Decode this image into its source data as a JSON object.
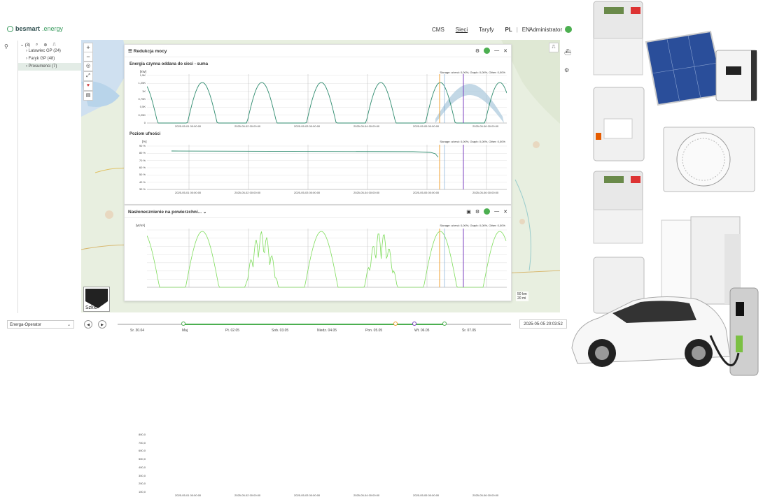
{
  "header": {
    "logo_brand": "besmart",
    "logo_suffix": ".energy",
    "nav": [
      "CMS",
      "Sieci",
      "Taryfy"
    ],
    "nav_active": "Sieci",
    "lang_pl": "PL",
    "lang_sep": "|",
    "lang_en": "EN",
    "user": "Administrator"
  },
  "tree": {
    "root": "(3)",
    "items": [
      {
        "label": "Latawiec GP (24)",
        "selected": false
      },
      {
        "label": "Faryk GP (48)",
        "selected": false
      },
      {
        "label": "Prosumenci (7)",
        "selected": true
      }
    ]
  },
  "panel1": {
    "title": "Redukcja mocy",
    "chart1": {
      "title": "Energia czynna oddana do sieci - suma",
      "unit": "[kW]",
      "stat": "Storage: at end: 0,00%, Graph: 0,00%, Other: 0,00%",
      "yticks": [
        "1,5K",
        "1,25K",
        "1K",
        "0,75K",
        "0,5K",
        "0,25K",
        "0"
      ],
      "xticks": [
        "2025-05-01 00:00:00",
        "2025-05-02 00:00:00",
        "2025-05-03 00:00:00",
        "2025-05-04 00:00:00",
        "2025-05-05 00:00:00",
        "2025-05-06 00:00:00"
      ]
    },
    "chart2": {
      "title": "Poziom ufności",
      "unit": "[%]",
      "stat": "Storage: at end: 0,00%, Graph: 0,00%, Other: 0,00%",
      "yticks": [
        "90 %",
        "80 %",
        "70 %",
        "60 %",
        "50 %",
        "40 %",
        "30 %"
      ],
      "xticks": [
        "2025-05-01 00:00:00",
        "2025-05-02 00:00:00",
        "2025-05-03 00:00:00",
        "2025-05-04 00:00:00",
        "2025-05-05 00:00:00",
        "2025-05-06 00:00:00"
      ]
    }
  },
  "panel2": {
    "title": "Nasłonecznienie na powierzchni...",
    "unit": "[W/m²]",
    "stat": "Storage: at end: 0,00%, Graph: 0,00%, Other: 0,00%",
    "yticks": [
      "800,0",
      "700,0",
      "600,0",
      "500,0",
      "400,0",
      "300,0",
      "200,0",
      "100,0"
    ],
    "xticks": [
      "2025-05-01 00:00:00",
      "2025-05-02 00:00:00",
      "2025-05-03 00:00:00",
      "2025-05-04 00:00:00",
      "2025-05-05 00:00:00",
      "2025-05-06 00:00:00"
    ]
  },
  "map": {
    "mini_label": "Szkic",
    "scale_top": "50 km",
    "scale_bottom": "20 mi"
  },
  "bottom": {
    "operator": "Energa-Operator",
    "datetime": "2025-05-05 20:03:52",
    "timeline": [
      "Sr. 30.04",
      "Maj",
      "Pt. 02.05",
      "Sob. 03.05",
      "Niedz. 04.05",
      "Pon. 05.05",
      "Wt. 06.05",
      "Śr. 07.05"
    ]
  },
  "colors": {
    "accent": "#4caf50",
    "orange": "#f0a030",
    "purple": "#7b3fbf",
    "line": "#2e8b6e",
    "band": "#aac8dc",
    "light_green": "#7ddc5a"
  }
}
